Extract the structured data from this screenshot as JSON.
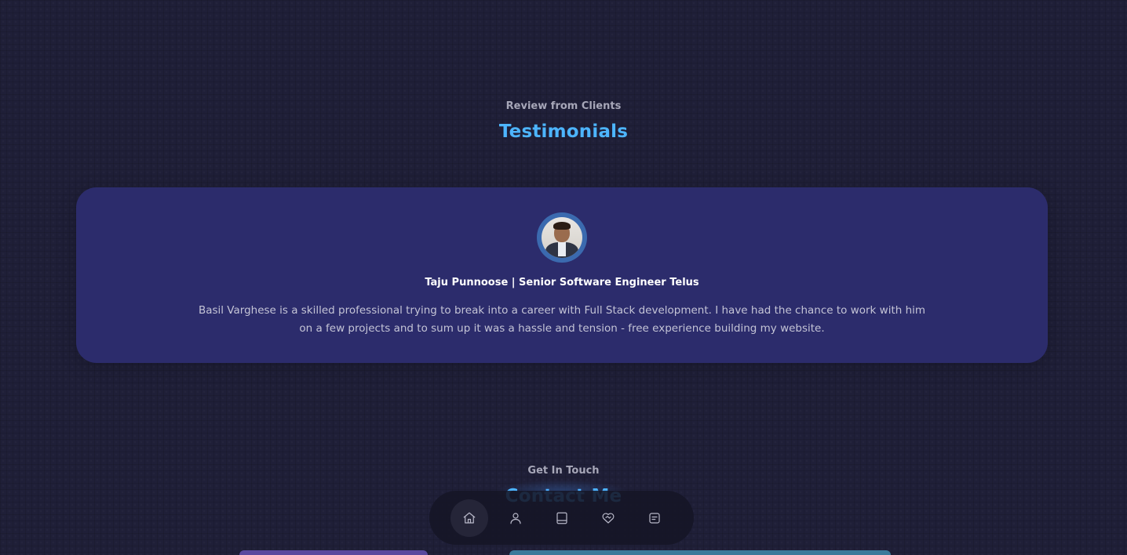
{
  "testimonials": {
    "subtitle": "Review from Clients",
    "title": "Testimonials",
    "items": [
      {
        "avatar": "person-photo",
        "reviewer": "Taju Punnoose | Senior Software Engineer Telus",
        "review": "Basil Varghese is a skilled professional trying to break into a career with Full Stack development. I have had the chance to work with him on a few projects and to sum up it was a hassle and tension - free experience building my website."
      }
    ]
  },
  "contact": {
    "subtitle": "Get In Touch",
    "title": "Contact Me"
  },
  "nav": {
    "items": [
      {
        "icon": "home-icon",
        "active": true
      },
      {
        "icon": "user-icon",
        "active": false
      },
      {
        "icon": "book-icon",
        "active": false
      },
      {
        "icon": "handshake-icon",
        "active": false
      },
      {
        "icon": "message-icon",
        "active": false
      }
    ]
  },
  "colors": {
    "background": "#1f1f38",
    "card": "#2c2c6c",
    "accent": "#4db5ff"
  }
}
